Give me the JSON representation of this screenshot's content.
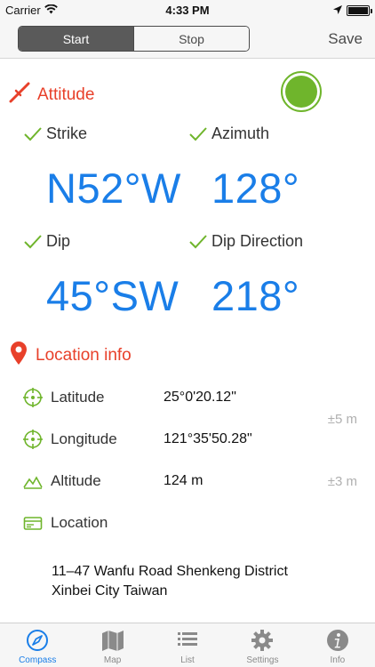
{
  "status_bar": {
    "carrier": "Carrier",
    "time": "4:33 PM"
  },
  "nav": {
    "segments": [
      "Start",
      "Stop"
    ],
    "active_segment": "Start",
    "save_label": "Save"
  },
  "attitude": {
    "title": "Attitude",
    "strike_label": "Strike",
    "strike_value": "N52°W",
    "azimuth_label": "Azimuth",
    "azimuth_value": "128°",
    "dip_label": "Dip",
    "dip_value": "45°SW",
    "dip_direction_label": "Dip Direction",
    "dip_direction_value": "218°"
  },
  "location": {
    "title": "Location info",
    "latitude_label": "Latitude",
    "latitude_value": "25°0'20.12\"",
    "longitude_label": "Longitude",
    "longitude_value": "121°35'50.28\"",
    "horizontal_accuracy": "±5 m",
    "altitude_label": "Altitude",
    "altitude_value": "124 m",
    "altitude_accuracy": "±3 m",
    "location_label": "Location",
    "address_line1": "11–47 Wanfu Road Shenkeng District",
    "address_line2": "Xinbei City Taiwan"
  },
  "tabs": [
    {
      "label": "Compass",
      "icon": "compass-icon",
      "active": true
    },
    {
      "label": "Map",
      "icon": "map-icon",
      "active": false
    },
    {
      "label": "List",
      "icon": "list-icon",
      "active": false
    },
    {
      "label": "Settings",
      "icon": "gear-icon",
      "active": false
    },
    {
      "label": "Info",
      "icon": "info-icon",
      "active": false
    }
  ],
  "colors": {
    "accent_blue": "#1a7ee8",
    "header_red": "#e8402a",
    "check_green": "#6fb52c"
  }
}
